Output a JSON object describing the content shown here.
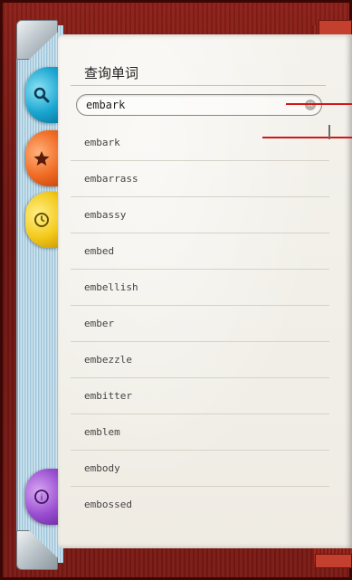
{
  "header": {
    "title": "查询单词"
  },
  "search": {
    "value": "embark",
    "clear_icon": "clear-icon"
  },
  "tabs": [
    {
      "name": "search-tab",
      "icon": "search-icon",
      "color": "#1aa6d1"
    },
    {
      "name": "favorites-tab",
      "icon": "star-icon",
      "color": "#f06a23"
    },
    {
      "name": "history-tab",
      "icon": "clock-icon",
      "color": "#f3c91a"
    },
    {
      "name": "about-tab",
      "icon": "info-icon",
      "color": "#9a4fd1"
    }
  ],
  "results": [
    "embark",
    "embarrass",
    "embassy",
    "embed",
    "embellish",
    "ember",
    "embezzle",
    "embitter",
    "emblem",
    "embody",
    "embossed"
  ],
  "colors": {
    "frame": "#7a1914",
    "paper": "#f2efe8",
    "annotation": "#d01818"
  }
}
